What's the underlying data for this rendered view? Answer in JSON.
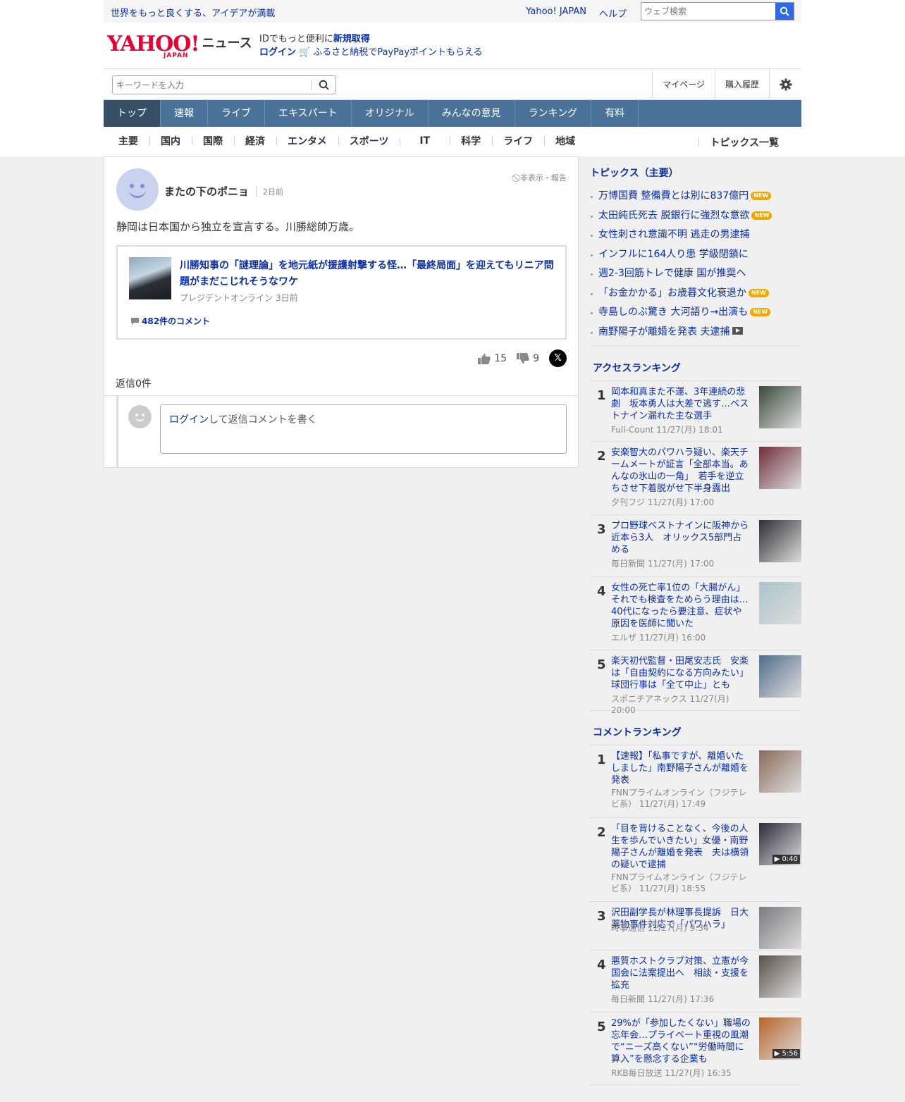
{
  "util": {
    "tagline": "世界をもっと良くする、アイデアが満載",
    "links": [
      "Yahoo! JAPAN",
      "ヘルプ"
    ],
    "search_placeholder": "ウェブ検索"
  },
  "header": {
    "logo": "YAHOO!",
    "logo_sub": "JAPAN",
    "section": "ニュース",
    "promo1": "IDでもっと便利に",
    "promo1_link": "新規取得",
    "login": "ログイン",
    "promo2": "ふるさと納税でPayPayポイントもらえる"
  },
  "searchbar": {
    "placeholder": "キーワードを入力",
    "mypage": "マイページ",
    "history": "購入履歴"
  },
  "gnav": [
    "トップ",
    "速報",
    "ライブ",
    "エキスパート",
    "オリジナル",
    "みんなの意見",
    "ランキング",
    "有料"
  ],
  "cnav": [
    "主要",
    "国内",
    "国際",
    "経済",
    "エンタメ",
    "スポーツ",
    "IT",
    "科学",
    "ライフ",
    "地域"
  ],
  "cnav_all": "トピックス一覧",
  "comment": {
    "user": "またの下のポニョ",
    "time": "2日前",
    "report": "非表示・報告",
    "text": "静岡は日本国から独立を宣言する。川勝総帥万歳。",
    "article": {
      "title": "川勝知事の「謎理論」を地元紙が援護射撃する怪…「最終局面」を迎えてもリニア問題がまだこじれそうなワケ",
      "source": "プレジデントオンライン 3日前",
      "comments": "482件のコメント"
    },
    "likes": "15",
    "dislikes": "9",
    "replies": "返信0件",
    "reply_login": "ログイン",
    "reply_placeholder": "して返信コメントを書く"
  },
  "topics": {
    "title": "トピックス（主要）",
    "items": [
      {
        "text": "万博国費 整備費とは別に837億円",
        "badge": "NEW"
      },
      {
        "text": "太田純氏死去 脱銀行に強烈な意欲",
        "badge": "NEW"
      },
      {
        "text": "女性刺され意識不明 逃走の男逮捕",
        "badge": ""
      },
      {
        "text": "インフルに164人り患 学級閉鎖に",
        "badge": ""
      },
      {
        "text": "週2-3回筋トレで健康 国が推奨へ",
        "badge": ""
      },
      {
        "text": "「お金かかる」お歳暮文化衰退か",
        "badge": "NEW"
      },
      {
        "text": "寺島しのぶ驚き 大河語り→出演も",
        "badge": "NEW"
      },
      {
        "text": "南野陽子が離婚を発表 夫逮捕",
        "badge": "video"
      }
    ]
  },
  "access": {
    "title": "アクセスランキング",
    "items": [
      {
        "n": "1",
        "title": "岡本和真また不運、3年連続の悲劇　坂本勇人は大差で逃す…ベストナイン漏れた主な選手",
        "src": "Full-Count 11/27(月) 18:01",
        "color": "#3a4a3a"
      },
      {
        "n": "2",
        "title": "安楽智大のパワハラ疑い、楽天チームメートが証言「全部本当。あんなの氷山の一角」　若手を逆立ちさせ下着脱がせ下半身露出",
        "src": "夕刊フジ 11/27(月) 17:00",
        "color": "#6e2e3a"
      },
      {
        "n": "3",
        "title": "プロ野球ベストナインに阪神から近本ら3人　オリックス5部門占める",
        "src": "毎日新聞 11/27(月) 17:00",
        "color": "#2d2d33"
      },
      {
        "n": "4",
        "title": "女性の死亡率1位の「大腸がん」それでも検査をためらう理由は…40代になったら要注意、症状や原因を医師に聞いた",
        "src": "エルザ 11/27(月) 16:00",
        "color": "#a9c4cc"
      },
      {
        "n": "5",
        "title": "楽天初代監督・田尾安志氏　安楽は「自由契約になる方向みたい」球団行事は「全て中止」とも",
        "src": "スポニチアネックス 11/27(月) 20:00",
        "color": "#4f6d8a"
      }
    ]
  },
  "commentrank": {
    "title": "コメントランキング",
    "items": [
      {
        "n": "1",
        "title": "【速報】「私事ですが、離婚いたしました」南野陽子さんが離婚を発表",
        "src": "FNNプライムオンライン（フジテレビ系） 11/27(月) 17:49",
        "color": "#8a6b5a",
        "dur": ""
      },
      {
        "n": "2",
        "title": "「目を背けることなく、今後の人生を歩んでいきたい」女優・南野陽子さんが離婚を発表　夫は横領の疑いで逮捕",
        "src": "FNNプライムオンライン（フジテレビ系） 11/27(月) 18:55",
        "color": "#2e2a3a",
        "dur": "0:40"
      },
      {
        "n": "3",
        "title": "沢田副学長が林理事長提訴　日大薬物事件対応で「パワハラ」",
        "src": "時事通信 11/27(月) 9:34",
        "color": "#7a7a80",
        "dur": ""
      },
      {
        "n": "4",
        "title": "悪質ホストクラブ対策、立憲が今国会に法案提出へ　相談・支援を拡充",
        "src": "毎日新聞 11/27(月) 17:36",
        "color": "#5a5048",
        "dur": ""
      },
      {
        "n": "5",
        "title": "29%が「参加したくない」職場の忘年会…プライベート重視の風潮で“ニーズ高くない”“労働時間に算入”を懸念する企業も",
        "src": "RKB毎日放送 11/27(月) 16:35",
        "color": "#b8642a",
        "dur": "5:56"
      }
    ]
  }
}
